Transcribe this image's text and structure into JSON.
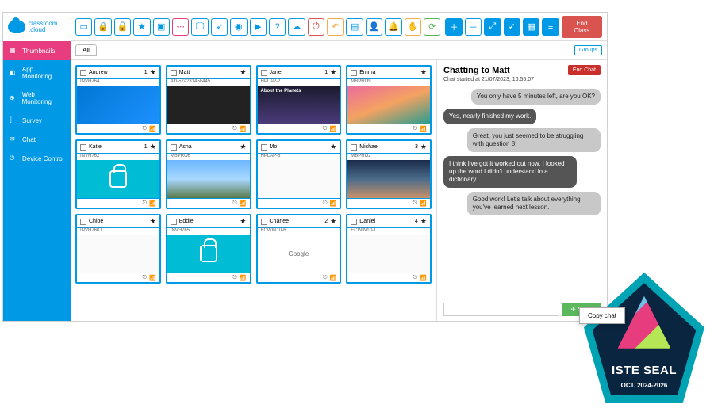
{
  "brand": {
    "name1": "classroom",
    "name2": ".cloud"
  },
  "sidebar": {
    "items": [
      {
        "label": "Thumbnails",
        "icon": "grid"
      },
      {
        "label": "App Monitoring",
        "icon": "app"
      },
      {
        "label": "Web Monitoring",
        "icon": "globe"
      },
      {
        "label": "Survey",
        "icon": "chart"
      },
      {
        "label": "Chat",
        "icon": "chat"
      },
      {
        "label": "Device Control",
        "icon": "power"
      }
    ]
  },
  "toolbar": {
    "endclass": "End Class"
  },
  "tabs": {
    "all": "All",
    "groups": "Groups"
  },
  "students": [
    {
      "name": "Andrew",
      "device": "INVH764",
      "num": "1",
      "screen": "win10"
    },
    {
      "name": "Matt",
      "device": "AD-52a231458445",
      "num": "",
      "screen": "dark"
    },
    {
      "name": "Jane",
      "device": "HPLAP-2",
      "num": "1",
      "screen": "planet",
      "caption": "About the Planets"
    },
    {
      "name": "Emma",
      "device": "MBPRO9",
      "num": "",
      "screen": "macwave"
    },
    {
      "name": "Katie",
      "device": "INVH762",
      "num": "1",
      "screen": "lock"
    },
    {
      "name": "Asha",
      "device": "MBPRO6",
      "num": "",
      "screen": "mtns"
    },
    {
      "name": "Mo",
      "device": "HPLAP-6",
      "num": "",
      "screen": "white"
    },
    {
      "name": "Michael",
      "device": "MBPRO2",
      "num": "3",
      "screen": "macd"
    },
    {
      "name": "Chloe",
      "device": "INVH760T",
      "num": "",
      "screen": "white"
    },
    {
      "name": "Eddie",
      "device": "INVH765",
      "num": "",
      "screen": "lock"
    },
    {
      "name": "Charlee",
      "device": "ECWIN10-6",
      "num": "2",
      "screen": "google",
      "caption": "Google"
    },
    {
      "name": "Daniel",
      "device": "ECWIN10-1",
      "num": "4",
      "screen": "white"
    }
  ],
  "chat": {
    "title": "Chatting to Matt",
    "started": "Chat started at 21/07/2023, 16:55:07",
    "endchat": "End Chat",
    "send": "Send",
    "ctx": "Copy chat",
    "msgs": [
      {
        "dir": "in",
        "text": "You only have 5 minutes left, are you OK?"
      },
      {
        "dir": "out",
        "text": "Yes, nearly finished my work."
      },
      {
        "dir": "in",
        "text": "Great, you just seemed to be struggling with question 8!"
      },
      {
        "dir": "out",
        "text": "I think I've got it worked out now, I looked up the word I didn't understand in a dictionary."
      },
      {
        "dir": "in",
        "text": "Good work! Let's talk about everything you've learned next lesson."
      }
    ]
  },
  "seal": {
    "title": "ISTE SEAL",
    "date": "OCT. 2024-2026"
  }
}
